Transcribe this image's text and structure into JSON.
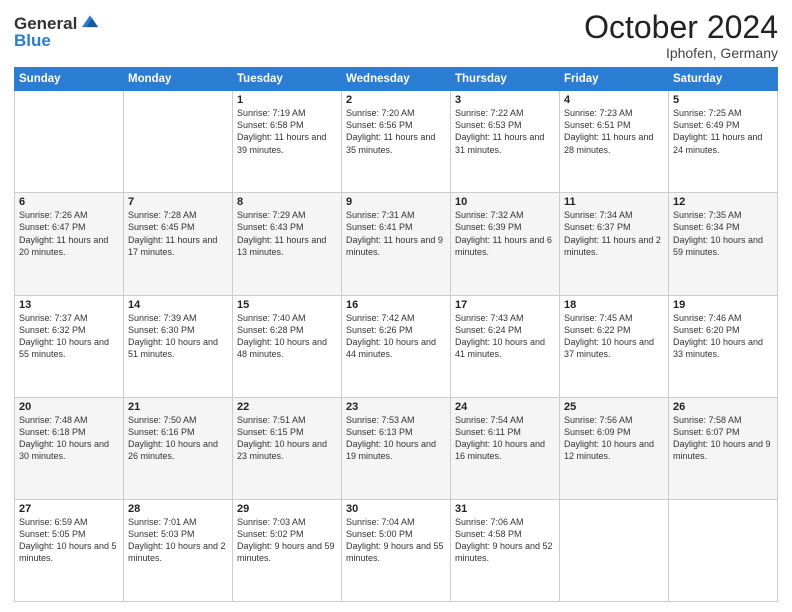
{
  "header": {
    "logo_line1": "General",
    "logo_line2": "Blue",
    "month": "October 2024",
    "location": "Iphofen, Germany"
  },
  "weekdays": [
    "Sunday",
    "Monday",
    "Tuesday",
    "Wednesday",
    "Thursday",
    "Friday",
    "Saturday"
  ],
  "weeks": [
    [
      {
        "day": "",
        "info": ""
      },
      {
        "day": "",
        "info": ""
      },
      {
        "day": "1",
        "info": "Sunrise: 7:19 AM\nSunset: 6:58 PM\nDaylight: 11 hours and 39 minutes."
      },
      {
        "day": "2",
        "info": "Sunrise: 7:20 AM\nSunset: 6:56 PM\nDaylight: 11 hours and 35 minutes."
      },
      {
        "day": "3",
        "info": "Sunrise: 7:22 AM\nSunset: 6:53 PM\nDaylight: 11 hours and 31 minutes."
      },
      {
        "day": "4",
        "info": "Sunrise: 7:23 AM\nSunset: 6:51 PM\nDaylight: 11 hours and 28 minutes."
      },
      {
        "day": "5",
        "info": "Sunrise: 7:25 AM\nSunset: 6:49 PM\nDaylight: 11 hours and 24 minutes."
      }
    ],
    [
      {
        "day": "6",
        "info": "Sunrise: 7:26 AM\nSunset: 6:47 PM\nDaylight: 11 hours and 20 minutes."
      },
      {
        "day": "7",
        "info": "Sunrise: 7:28 AM\nSunset: 6:45 PM\nDaylight: 11 hours and 17 minutes."
      },
      {
        "day": "8",
        "info": "Sunrise: 7:29 AM\nSunset: 6:43 PM\nDaylight: 11 hours and 13 minutes."
      },
      {
        "day": "9",
        "info": "Sunrise: 7:31 AM\nSunset: 6:41 PM\nDaylight: 11 hours and 9 minutes."
      },
      {
        "day": "10",
        "info": "Sunrise: 7:32 AM\nSunset: 6:39 PM\nDaylight: 11 hours and 6 minutes."
      },
      {
        "day": "11",
        "info": "Sunrise: 7:34 AM\nSunset: 6:37 PM\nDaylight: 11 hours and 2 minutes."
      },
      {
        "day": "12",
        "info": "Sunrise: 7:35 AM\nSunset: 6:34 PM\nDaylight: 10 hours and 59 minutes."
      }
    ],
    [
      {
        "day": "13",
        "info": "Sunrise: 7:37 AM\nSunset: 6:32 PM\nDaylight: 10 hours and 55 minutes."
      },
      {
        "day": "14",
        "info": "Sunrise: 7:39 AM\nSunset: 6:30 PM\nDaylight: 10 hours and 51 minutes."
      },
      {
        "day": "15",
        "info": "Sunrise: 7:40 AM\nSunset: 6:28 PM\nDaylight: 10 hours and 48 minutes."
      },
      {
        "day": "16",
        "info": "Sunrise: 7:42 AM\nSunset: 6:26 PM\nDaylight: 10 hours and 44 minutes."
      },
      {
        "day": "17",
        "info": "Sunrise: 7:43 AM\nSunset: 6:24 PM\nDaylight: 10 hours and 41 minutes."
      },
      {
        "day": "18",
        "info": "Sunrise: 7:45 AM\nSunset: 6:22 PM\nDaylight: 10 hours and 37 minutes."
      },
      {
        "day": "19",
        "info": "Sunrise: 7:46 AM\nSunset: 6:20 PM\nDaylight: 10 hours and 33 minutes."
      }
    ],
    [
      {
        "day": "20",
        "info": "Sunrise: 7:48 AM\nSunset: 6:18 PM\nDaylight: 10 hours and 30 minutes."
      },
      {
        "day": "21",
        "info": "Sunrise: 7:50 AM\nSunset: 6:16 PM\nDaylight: 10 hours and 26 minutes."
      },
      {
        "day": "22",
        "info": "Sunrise: 7:51 AM\nSunset: 6:15 PM\nDaylight: 10 hours and 23 minutes."
      },
      {
        "day": "23",
        "info": "Sunrise: 7:53 AM\nSunset: 6:13 PM\nDaylight: 10 hours and 19 minutes."
      },
      {
        "day": "24",
        "info": "Sunrise: 7:54 AM\nSunset: 6:11 PM\nDaylight: 10 hours and 16 minutes."
      },
      {
        "day": "25",
        "info": "Sunrise: 7:56 AM\nSunset: 6:09 PM\nDaylight: 10 hours and 12 minutes."
      },
      {
        "day": "26",
        "info": "Sunrise: 7:58 AM\nSunset: 6:07 PM\nDaylight: 10 hours and 9 minutes."
      }
    ],
    [
      {
        "day": "27",
        "info": "Sunrise: 6:59 AM\nSunset: 5:05 PM\nDaylight: 10 hours and 5 minutes."
      },
      {
        "day": "28",
        "info": "Sunrise: 7:01 AM\nSunset: 5:03 PM\nDaylight: 10 hours and 2 minutes."
      },
      {
        "day": "29",
        "info": "Sunrise: 7:03 AM\nSunset: 5:02 PM\nDaylight: 9 hours and 59 minutes."
      },
      {
        "day": "30",
        "info": "Sunrise: 7:04 AM\nSunset: 5:00 PM\nDaylight: 9 hours and 55 minutes."
      },
      {
        "day": "31",
        "info": "Sunrise: 7:06 AM\nSunset: 4:58 PM\nDaylight: 9 hours and 52 minutes."
      },
      {
        "day": "",
        "info": ""
      },
      {
        "day": "",
        "info": ""
      }
    ]
  ]
}
